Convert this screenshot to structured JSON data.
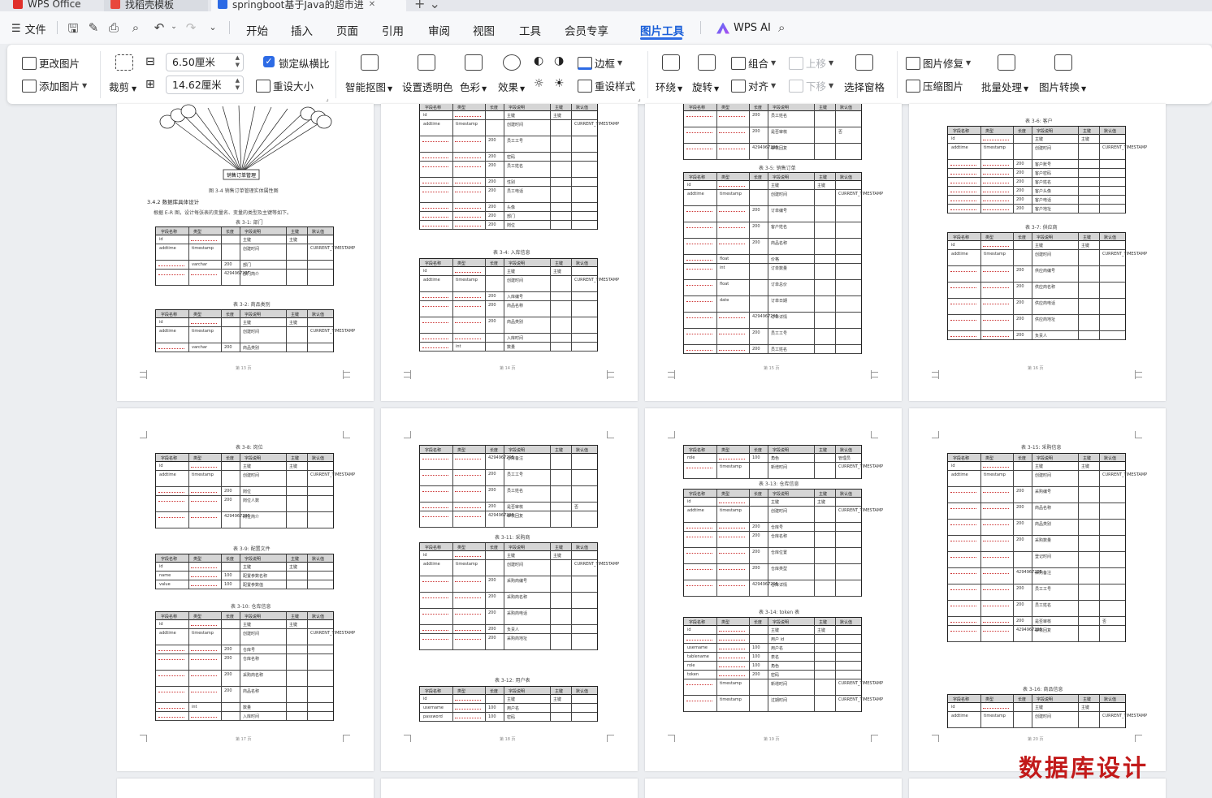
{
  "tabs": [
    {
      "label": "WPS Office"
    },
    {
      "label": "找稻壳模板"
    },
    {
      "label": "springboot基于Java的超市进"
    }
  ],
  "menu": {
    "file": "文件",
    "items": [
      "开始",
      "插入",
      "页面",
      "引用",
      "审阅",
      "视图",
      "工具",
      "会员专享",
      "图片工具"
    ],
    "active": "图片工具",
    "ai": "WPS AI"
  },
  "ribbon": {
    "change_image": "更改图片",
    "add_image": "添加图片",
    "crop": "裁剪",
    "width_value": "6.50厘米",
    "height_value": "14.62厘米",
    "lock_ratio": "锁定纵横比",
    "reset_size": "重设大小",
    "smart_cutout": "智能抠图",
    "set_transparent": "设置透明色",
    "color": "色彩",
    "effect": "效果",
    "border": "边框",
    "reset_style": "重设样式",
    "wrap": "环绕",
    "rotate": "旋转",
    "group": "组合",
    "align": "对齐",
    "move_up": "上移",
    "move_down": "下移",
    "selection_pane": "选择窗格",
    "image_repair": "图片修复",
    "compress": "压缩图片",
    "batch": "批量处理",
    "convert": "图片转换"
  },
  "document": {
    "figure_caption": "图 3-4 销售订单管理实体属性图",
    "figure_root": "销售订单管理",
    "section_heading": "3.4.2 数据库具体设计",
    "section_text": "根据 E-R 图，设计每张表的变量名、变量的类型及主键等如下。",
    "col_headers": [
      "字段名称",
      "类型",
      "长度",
      "字段说明",
      "主键",
      "默认值"
    ],
    "captions": {
      "t1": "表 3-1: 部门",
      "t2": "表 3-2: 商品类别",
      "t4": "表 3-4: 入库信息",
      "t5": "表 3-5: 销售订单",
      "t6": "表 3-6: 客户",
      "t7": "表 3-7: 供应商",
      "t8": "表 3-8: 岗位",
      "t9": "表 3-9: 配置文件",
      "t10": "表 3-10: 仓库信息",
      "t11": "表 3-11: 采购商",
      "t12": "表 3-12: 用户表",
      "t13": "表 3-13: 仓库信息",
      "t14": "表 3-14: token 表",
      "t15": "表 3-15: 采购信息",
      "t16": "表 3-16: 商品信息"
    },
    "cells": {
      "id": "id",
      "bigint": "bigint",
      "pk": "主键",
      "addtime": "addtime",
      "timestamp": "timestamp",
      "created": "创建时间",
      "current_ts": "CURRENT_TIMESTAMP",
      "varchar": "varchar",
      "len200": "200",
      "dept": "部门",
      "dept_intro": "部门简介",
      "longtext": "longtext",
      "longtext_len": "4294967295",
      "category": "商品类别",
      "name": "name",
      "value": "value",
      "cfg_name": "配置参数名称",
      "cfg_value": "配置参数值",
      "len100": "100",
      "username": "username",
      "password": "password",
      "username_cn": "用户名",
      "password_cn": "密码",
      "role": "role",
      "role_cn": "角色",
      "admin": "管理员",
      "token": "token",
      "tablename": "tablename",
      "table_cn": "表名",
      "expire": "expiratedtime",
      "expire_cn": "过期时间",
      "userid": "用户 id",
      "added": "新增时间",
      "int": "int",
      "float": "float",
      "date": "date",
      "qty": "数量",
      "position": "岗位",
      "pos_count": "岗位人数",
      "pos_intro": "岗位简介",
      "employee_no": "员工工号",
      "employee_name": "员工姓名",
      "pwd": "密码",
      "gender": "性别",
      "phone": "员工电话",
      "avatar": "头像",
      "is_review": "是否审核",
      "review_reply": "审核回复",
      "no": "否",
      "in_no": "入库编号",
      "goods_name": "商品名称",
      "in_time": "入库时间",
      "order_no": "订单编号",
      "customer_name": "客户姓名",
      "price": "价格",
      "order_qty": "订单数量",
      "order_total": "订单总价",
      "order_date": "订单日期",
      "order_detail": "订单详情",
      "customer_no": "客户账号",
      "customer_pwd": "客户密码",
      "customer_avatar": "客户头像",
      "customer_phone": "客户电话",
      "customer_addr": "客户地址",
      "supplier_no": "供应商编号",
      "supplier_name": "供应商名称",
      "supplier_phone": "供应商电话",
      "supplier_addr": "供应商地址",
      "manager": "负责人",
      "wh_name": "仓库名称",
      "buyer_no": "采购商编号",
      "buyer_name": "采购商名称",
      "buyer_phone": "采购商电话",
      "buyer_addr": "采购商地址",
      "wh_no": "仓库号",
      "wh_loc": "仓库位置",
      "wh_type": "仓库类型",
      "wh_detail": "仓库详情",
      "wh_remark": "仓库备注",
      "purchase_no": "采购编号",
      "purchase_qty": "采购数量",
      "reg_time": "登记时间",
      "purchase_remark": "采购备注",
      "goods_cat": "商品类别"
    },
    "page_numbers": [
      "第 13 页",
      "第 14 页",
      "第 15 页",
      "第 16 页",
      "第 17 页",
      "第 18 页",
      "第 19 页",
      "第 20 页"
    ]
  },
  "watermark": "数据库设计",
  "colors": {
    "accent": "#2d6be5",
    "watermark": "#c21a1a"
  }
}
